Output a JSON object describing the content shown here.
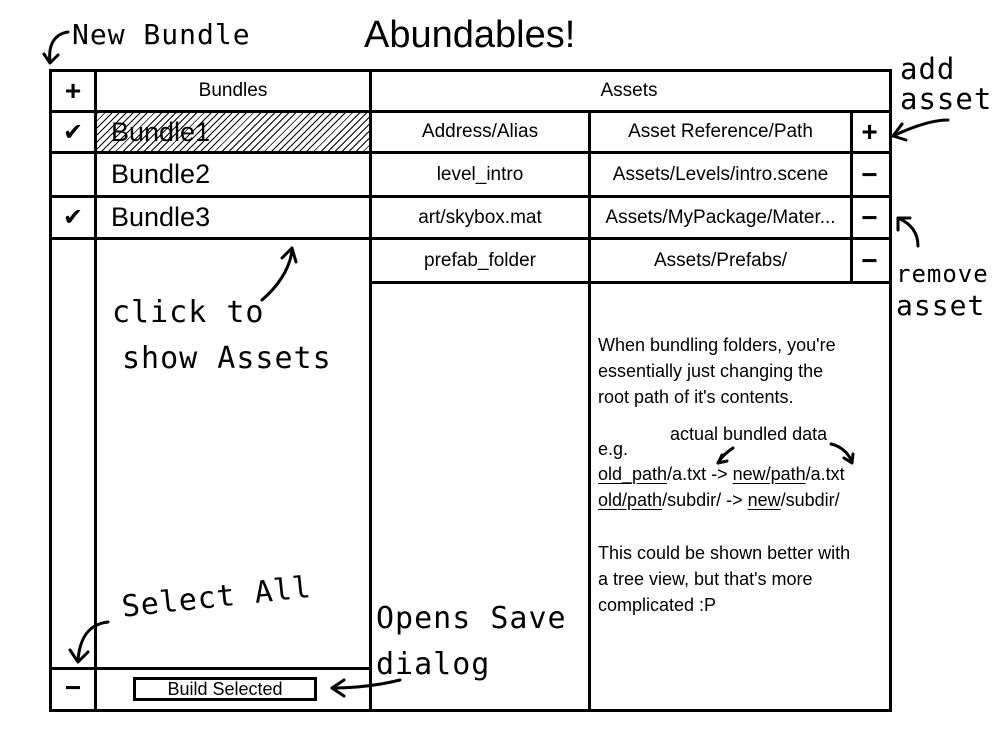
{
  "title": "Abundables!",
  "columns": {
    "bundles_header": "Bundles",
    "assets_header": "Assets"
  },
  "buttons": {
    "new_bundle": "+",
    "select_all": "−",
    "build": "Build Selected",
    "add_asset": "+",
    "remove_asset": "−"
  },
  "bundles": [
    {
      "name": "Bundle1",
      "checked": true,
      "check_glyph": "✔",
      "selected": true
    },
    {
      "name": "Bundle2",
      "checked": false,
      "check_glyph": "",
      "selected": false
    },
    {
      "name": "Bundle3",
      "checked": true,
      "check_glyph": "✔",
      "selected": false
    }
  ],
  "assets_table": {
    "headers": {
      "address": "Address/Alias",
      "path": "Asset Reference/Path"
    },
    "rows": [
      {
        "address": "level_intro",
        "path": "Assets/Levels/intro.scene"
      },
      {
        "address": "art/skybox.mat",
        "path": "Assets/MyPackage/Mater..."
      },
      {
        "address": "prefab_folder",
        "path": "Assets/Prefabs/"
      }
    ]
  },
  "note": {
    "p1_line1": "When bundling folders, you're",
    "p1_line2": "essentially just changing the",
    "p1_line3": "root path of it's contents.",
    "actual_label": "actual bundled data",
    "eg": "e.g.",
    "ex1_old": "old_path",
    "ex1_mid1": "/a.txt -> ",
    "ex1_new": "new/path",
    "ex1_mid2": "/a.txt",
    "ex2_old": "old/path",
    "ex2_mid1": "/subdir/ -> ",
    "ex2_new": "new",
    "ex2_mid2": "/subdir/",
    "p3_line1": "This could be shown better with",
    "p3_line2": "a tree view, but that's more",
    "p3_line3": "complicated :P"
  },
  "annotations": {
    "new_bundle": "New Bundle",
    "add_asset_1": "add",
    "add_asset_2": "asset",
    "remove_asset_1": "remove",
    "remove_asset_2": "asset",
    "click_1": "click to",
    "click_2": "show Assets",
    "select_all": "Select All",
    "opens_1": "Opens Save",
    "opens_2": "dialog"
  }
}
